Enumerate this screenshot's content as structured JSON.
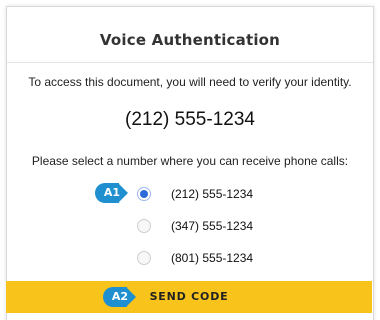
{
  "dialog": {
    "title": "Voice Authentication",
    "message": "To access this document, you will need to verify your identity.",
    "phone_number": "(212) 555-1234",
    "prompt": "Please select a number where you can receive phone calls:",
    "options": [
      {
        "label": "(212) 555-1234",
        "selected": true
      },
      {
        "label": "(347) 555-1234",
        "selected": false
      },
      {
        "label": "(801) 555-1234",
        "selected": false
      }
    ],
    "send_label": "SEND CODE"
  },
  "annotations": {
    "a1": "A1",
    "a2": "A2"
  },
  "colors": {
    "accent_button": "#f8c41c",
    "radio_selected": "#2d6ad9",
    "annotation_badge": "#1f8fcf"
  }
}
